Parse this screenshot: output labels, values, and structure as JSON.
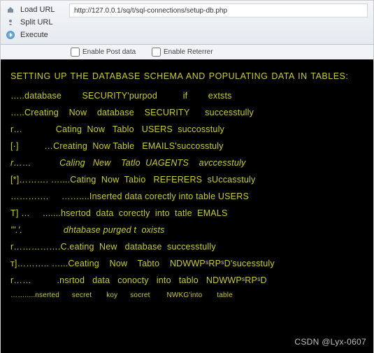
{
  "toolbar": {
    "load_label": "Load URL",
    "split_label": "Split URL",
    "execute_label": "Execute",
    "url_value": "http://127.0.0.1/sq/t/sql-connections/setup-db.php",
    "post_label": "Enable Post data",
    "referrer_label": "Enable Reterrer"
  },
  "output": {
    "title": "SETTING  UP THE DATABASE SCHEMA AND POPULATING DATA IN TABLES:",
    "lines": [
      "…..database        SECURITY'purpod          if        extsts",
      "…..Creating    Now    database    SECURITY      successtully",
      "r…             Cating  Now   Tablo   USERS  succosstuly",
      "[·]          …Creating  Now Table   EMAILS'succosstuly",
      "r……           Caling   New    Tatlo  UAGENTS    avccesstuly",
      "[*]………. …....Cating  Now  Tabio   REFERERS  sUccasstuly",
      "………….     ……....Inserted data corectly into table USERS",
      "T] …     .......hsertod  data  corectly  into  tatle  EMALS",
      "\"'.'.                dhtabase purged t  oxists",
      "r…………….C.eating  New   database  successtully",
      "ᴛ]……….. …...Ceating    Now    Tabto    NDWWPˢRPˢD'sucesstuly",
      "r……          .nsrtod   data   conocty   into   tablo   NDWWPˢRPˢD",
      "…….....nserted      secret       koy      socret        NWKG'into       table"
    ]
  },
  "watermark": "CSDN @Lyx-0607"
}
